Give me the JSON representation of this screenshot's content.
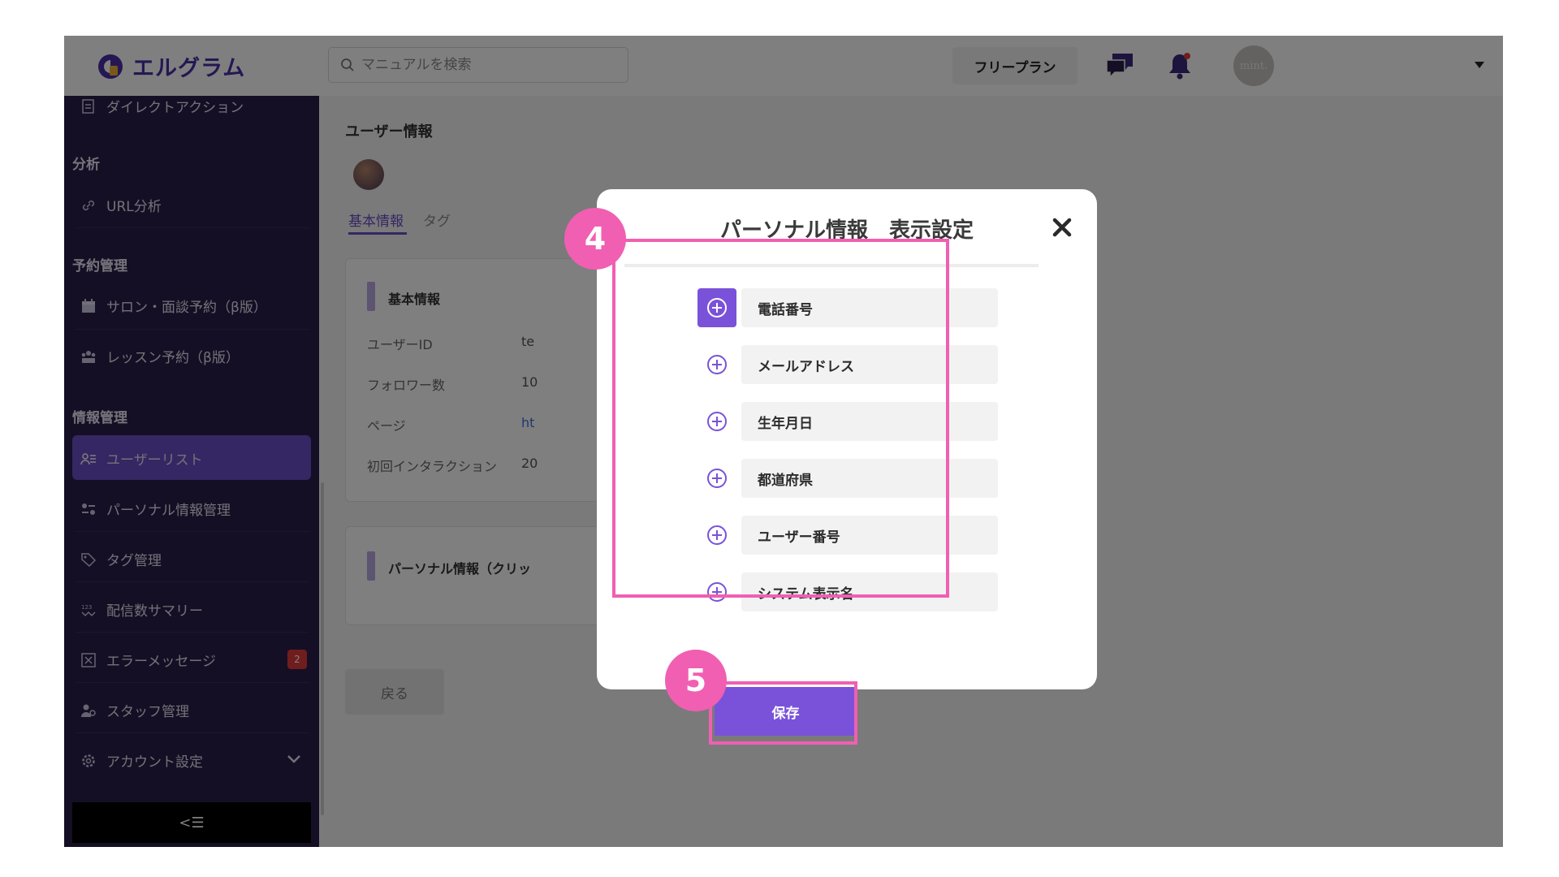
{
  "colors": {
    "brand": "#4b2fa8",
    "sidebar_bg": "#2b1f4a",
    "accent": "#7a52d9",
    "annotation": "#f05fb2",
    "badge": "#e03a3a"
  },
  "header": {
    "logo_text": "エルグラム",
    "search_placeholder": "マニュアルを検索",
    "plan_label": "フリープラン",
    "avatar_text": "mint.",
    "icons": [
      "chat-icon",
      "bell-icon",
      "chevron-down-icon"
    ]
  },
  "sidebar": {
    "top_item": "ダイレクトアクション",
    "sections": [
      {
        "heading": "分析",
        "items": [
          "URL分析"
        ]
      },
      {
        "heading": "予約管理",
        "items": [
          "サロン・面談予約（β版）",
          "レッスン予約（β版）"
        ]
      },
      {
        "heading": "情報管理",
        "items": [
          "ユーザーリスト",
          "パーソナル情報管理",
          "タグ管理",
          "配信数サマリー",
          "エラーメッセージ",
          "スタッフ管理",
          "アカウント設定"
        ]
      }
    ],
    "active_item": "ユーザーリスト",
    "error_badge_count": "2",
    "collapse_glyph": "<☰"
  },
  "main": {
    "title": "ユーザー情報",
    "tabs": [
      "基本情報",
      "タグ"
    ],
    "basic_card": {
      "heading": "基本情報",
      "fields": [
        {
          "label": "ユーザーID",
          "value": "te"
        },
        {
          "label": "フォロワー数",
          "value": "10"
        },
        {
          "label": "ページ",
          "value": "ht"
        },
        {
          "label": "初回インタラクション",
          "value": "20"
        }
      ]
    },
    "personal_card_heading": "パーソナル情報（クリッ",
    "back_button": "戻る"
  },
  "modal": {
    "title": "パーソナル情報　表示設定",
    "items": [
      "電話番号",
      "メールアドレス",
      "生年月日",
      "都道府県",
      "ユーザー番号",
      "システム表示名"
    ],
    "save_button": "保存"
  },
  "annotations": {
    "step_a": "4",
    "step_b": "5"
  }
}
